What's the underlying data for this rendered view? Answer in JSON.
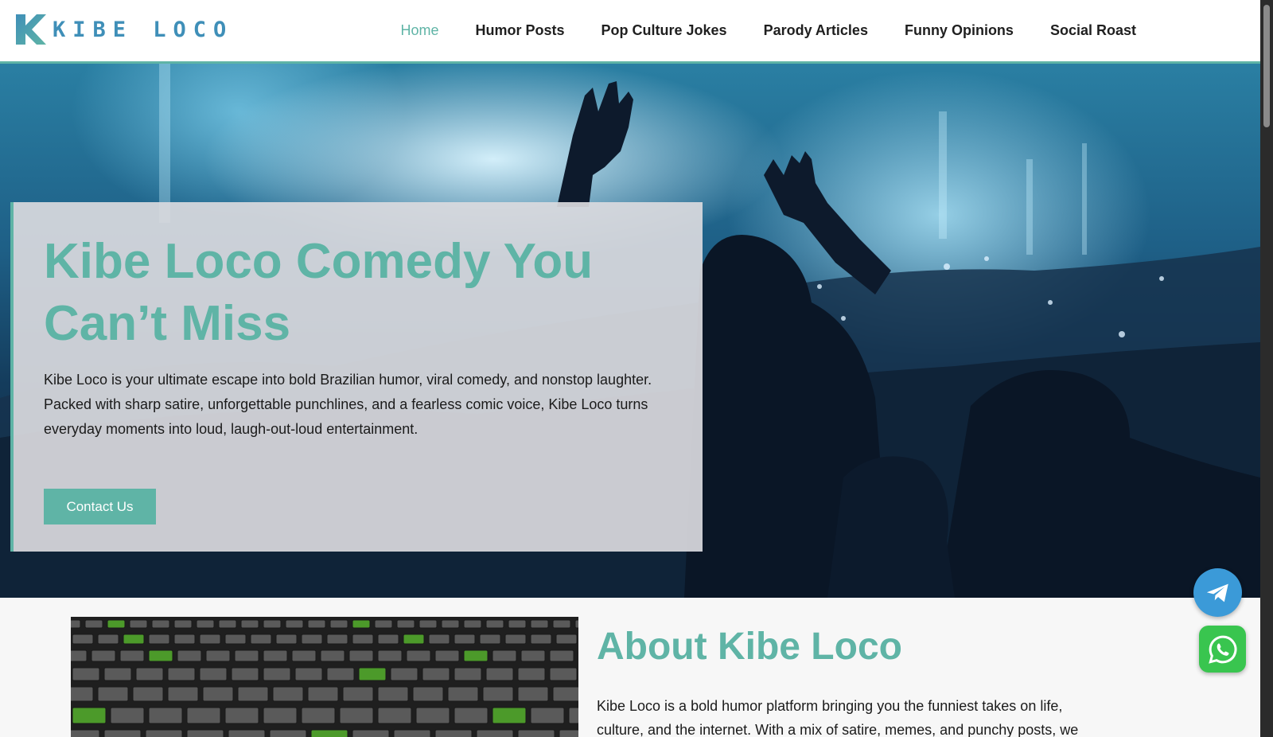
{
  "brand": {
    "name": "KIBE LOCO",
    "logo_icon": "k-logo-icon",
    "accent": "#5fb4a6"
  },
  "nav": {
    "items": [
      {
        "label": "Home",
        "active": true
      },
      {
        "label": "Humor Posts"
      },
      {
        "label": "Pop Culture Jokes"
      },
      {
        "label": "Parody Articles"
      },
      {
        "label": "Funny Opinions"
      },
      {
        "label": "Social Roast"
      }
    ]
  },
  "hero": {
    "title": "Kibe Loco Comedy You Can’t Miss",
    "text": "Kibe Loco is your ultimate escape into bold Brazilian humor, viral comedy, and nonstop laughter. Packed with sharp satire, unforgettable punchlines, and a fearless comic voice, Kibe Loco turns everyday moments into loud, laugh-out-loud entertainment.",
    "button": "Contact Us"
  },
  "about": {
    "title": "About Kibe Loco",
    "text": "Kibe Loco is a bold humor platform bringing you the funniest takes on life, culture, and the internet. With a mix of satire, memes, and punchy posts, we"
  },
  "floating": {
    "telegram_icon": "telegram-icon",
    "whatsapp_icon": "whatsapp-icon"
  }
}
